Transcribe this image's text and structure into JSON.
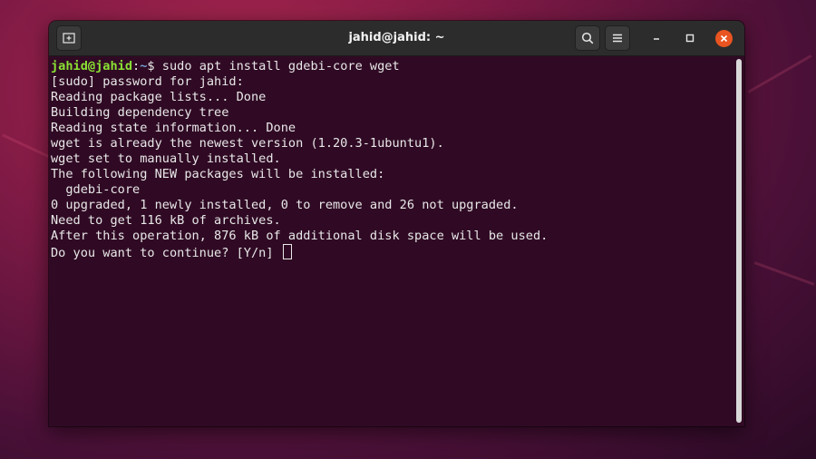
{
  "window": {
    "title": "jahid@jahid: ~"
  },
  "prompt": {
    "user_host": "jahid@jahid",
    "separator": ":",
    "path": "~",
    "symbol": "$ ",
    "command": "sudo apt install gdebi-core wget"
  },
  "output_lines": [
    "[sudo] password for jahid:",
    "Reading package lists... Done",
    "Building dependency tree",
    "Reading state information... Done",
    "wget is already the newest version (1.20.3-1ubuntu1).",
    "wget set to manually installed.",
    "The following NEW packages will be installed:",
    "  gdebi-core",
    "0 upgraded, 1 newly installed, 0 to remove and 26 not upgraded.",
    "Need to get 116 kB of archives.",
    "After this operation, 876 kB of additional disk space will be used.",
    "Do you want to continue? [Y/n] "
  ],
  "icons": {
    "new_tab": "new-tab-icon",
    "search": "search-icon",
    "menu": "hamburger-menu-icon",
    "minimize": "minimize-icon",
    "maximize": "maximize-icon",
    "close": "close-icon"
  },
  "colors": {
    "terminal_bg": "#300a24",
    "prompt_user": "#8ae234",
    "prompt_path": "#729fcf",
    "close_button": "#e95420"
  }
}
